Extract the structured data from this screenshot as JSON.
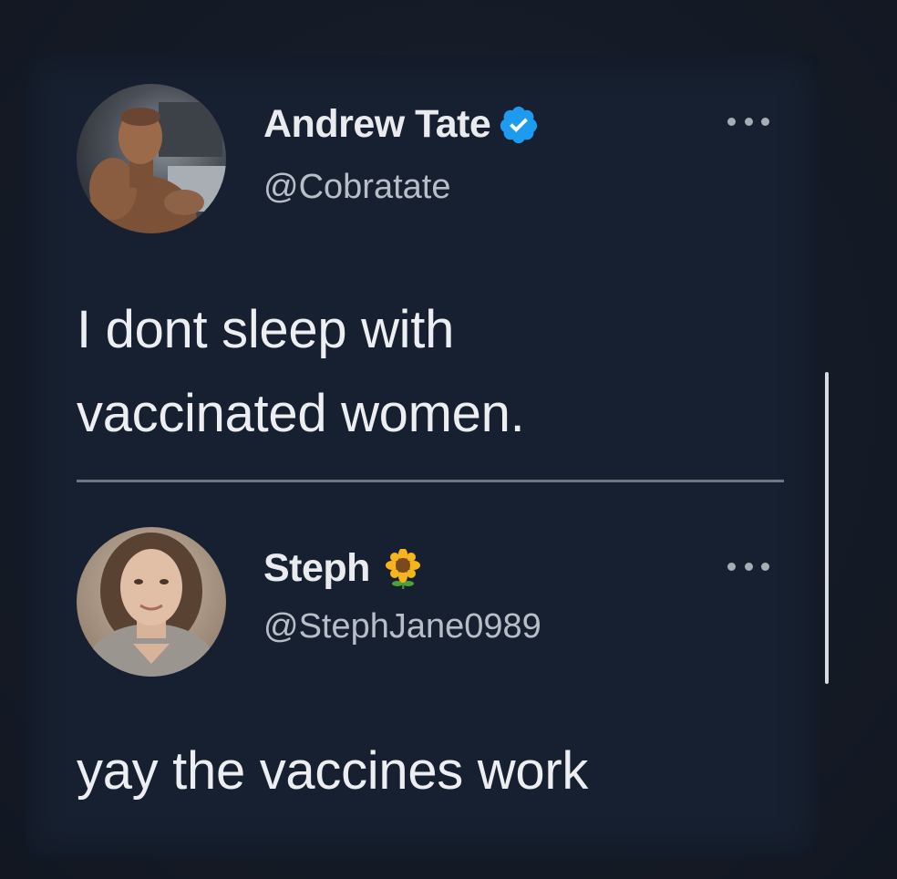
{
  "main_tweet": {
    "author": {
      "display_name": "Andrew Tate",
      "handle": "@Cobratate",
      "verified": true,
      "avatar_icon": "avatar-photo"
    },
    "text_line_1": "I dont sleep with",
    "text_line_2": "vaccinated women.",
    "more_icon": "more-horizontal-icon"
  },
  "reply_tweet": {
    "author": {
      "display_name": "Steph",
      "handle": "@StephJane0989",
      "name_emoji": "sunflower-icon",
      "avatar_icon": "avatar-photo"
    },
    "text": "yay the vaccines work",
    "more_icon": "more-horizontal-icon"
  },
  "colors": {
    "background": "#151a24",
    "verified_badge": "#1d9bf0",
    "text_primary": "#eceef1",
    "text_secondary": "#b8bec7"
  }
}
